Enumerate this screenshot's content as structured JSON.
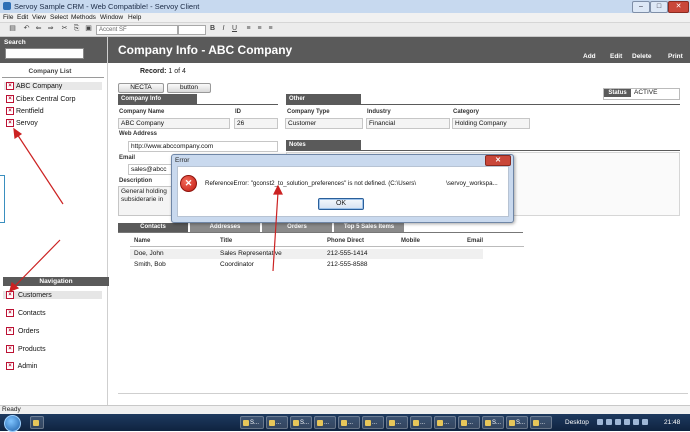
{
  "window": {
    "title": "Servoy Sample CRM - Web Compatible! - Servoy Client",
    "minimize": "–",
    "maximize": "□",
    "close": "✕"
  },
  "menu": [
    "File",
    "Edit",
    "View",
    "Select",
    "Methods",
    "Window",
    "Help"
  ],
  "toolbar": {
    "font_select": "Accent SF",
    "size_select": "",
    "icons": [
      "open-icon",
      "undo-icon",
      "back-icon",
      "forward-icon",
      "cut-icon",
      "copy-icon",
      "bold-icon",
      "italic-icon",
      "underline-icon"
    ]
  },
  "sidebar": {
    "search_label": "Search",
    "company_list_title": "Company List",
    "companies": [
      "ABC Company",
      "Cibex Central Corp",
      "Rentfield",
      "Servoy"
    ],
    "nav_title": "Navigation",
    "nav_items": [
      "Customers",
      "Contacts",
      "Orders",
      "Products",
      "Admin"
    ]
  },
  "main": {
    "title": "Company Info - ABC Company",
    "actions": [
      "Add",
      "Edit",
      "Delete",
      "Print"
    ],
    "record_prefix": "Record:",
    "record_value": "1 of 4",
    "buttons": [
      "NECTA",
      "button"
    ],
    "status_label": "Status",
    "status_value": "ACTIVE",
    "company_info": {
      "section": "Company Info",
      "name_label": "Company Name",
      "name_value": "ABC Company",
      "id_label": "ID",
      "id_value": "26",
      "web_label": "Web Address",
      "web_value": "http://www.abccompany.com",
      "email_label": "Email",
      "email_value": "sales@abcc",
      "desc_label": "Description",
      "desc_value_1": "General holding",
      "desc_value_2": "subsiderarie in"
    },
    "other": {
      "section": "Other",
      "type_label": "Company Type",
      "type_value": "Customer",
      "industry_label": "Industry",
      "industry_value": "Financial",
      "category_label": "Category",
      "category_value": "Holding Company",
      "notes_label": "Notes"
    },
    "tabs": [
      "Contacts",
      "Addresses",
      "Orders",
      "Top 5 Sales Items"
    ],
    "table": {
      "headers": [
        "Name",
        "Title",
        "Phone Direct",
        "Mobile",
        "Email"
      ],
      "rows": [
        [
          "Doe, John",
          "Sales Representative",
          "212-555-1414",
          "",
          ""
        ],
        [
          "Smith, Bob",
          "Coordinator",
          "212-555-8588",
          "",
          ""
        ]
      ]
    }
  },
  "dialog": {
    "title": "Error",
    "close": "✕",
    "message_1": "ReferenceError: \"gconst2_to_solution_preferences\" is not defined. (C:\\Users\\",
    "message_2": "\\servoy_workspa...",
    "ok": "OK"
  },
  "statusbar": {
    "text": "Ready"
  },
  "taskbar": {
    "buttons": [
      "S...",
      "...",
      "S...",
      "...",
      "...",
      "...",
      "...",
      "...",
      "...",
      "...",
      "S...",
      "S...",
      "...",
      "...",
      "U...",
      "S..."
    ],
    "desktop": "Desktop",
    "clock": "21:48"
  },
  "colors": {
    "header": "#5a5a5a",
    "annotation_arrow": "#cc2222",
    "error_icon": "#c41b12"
  }
}
